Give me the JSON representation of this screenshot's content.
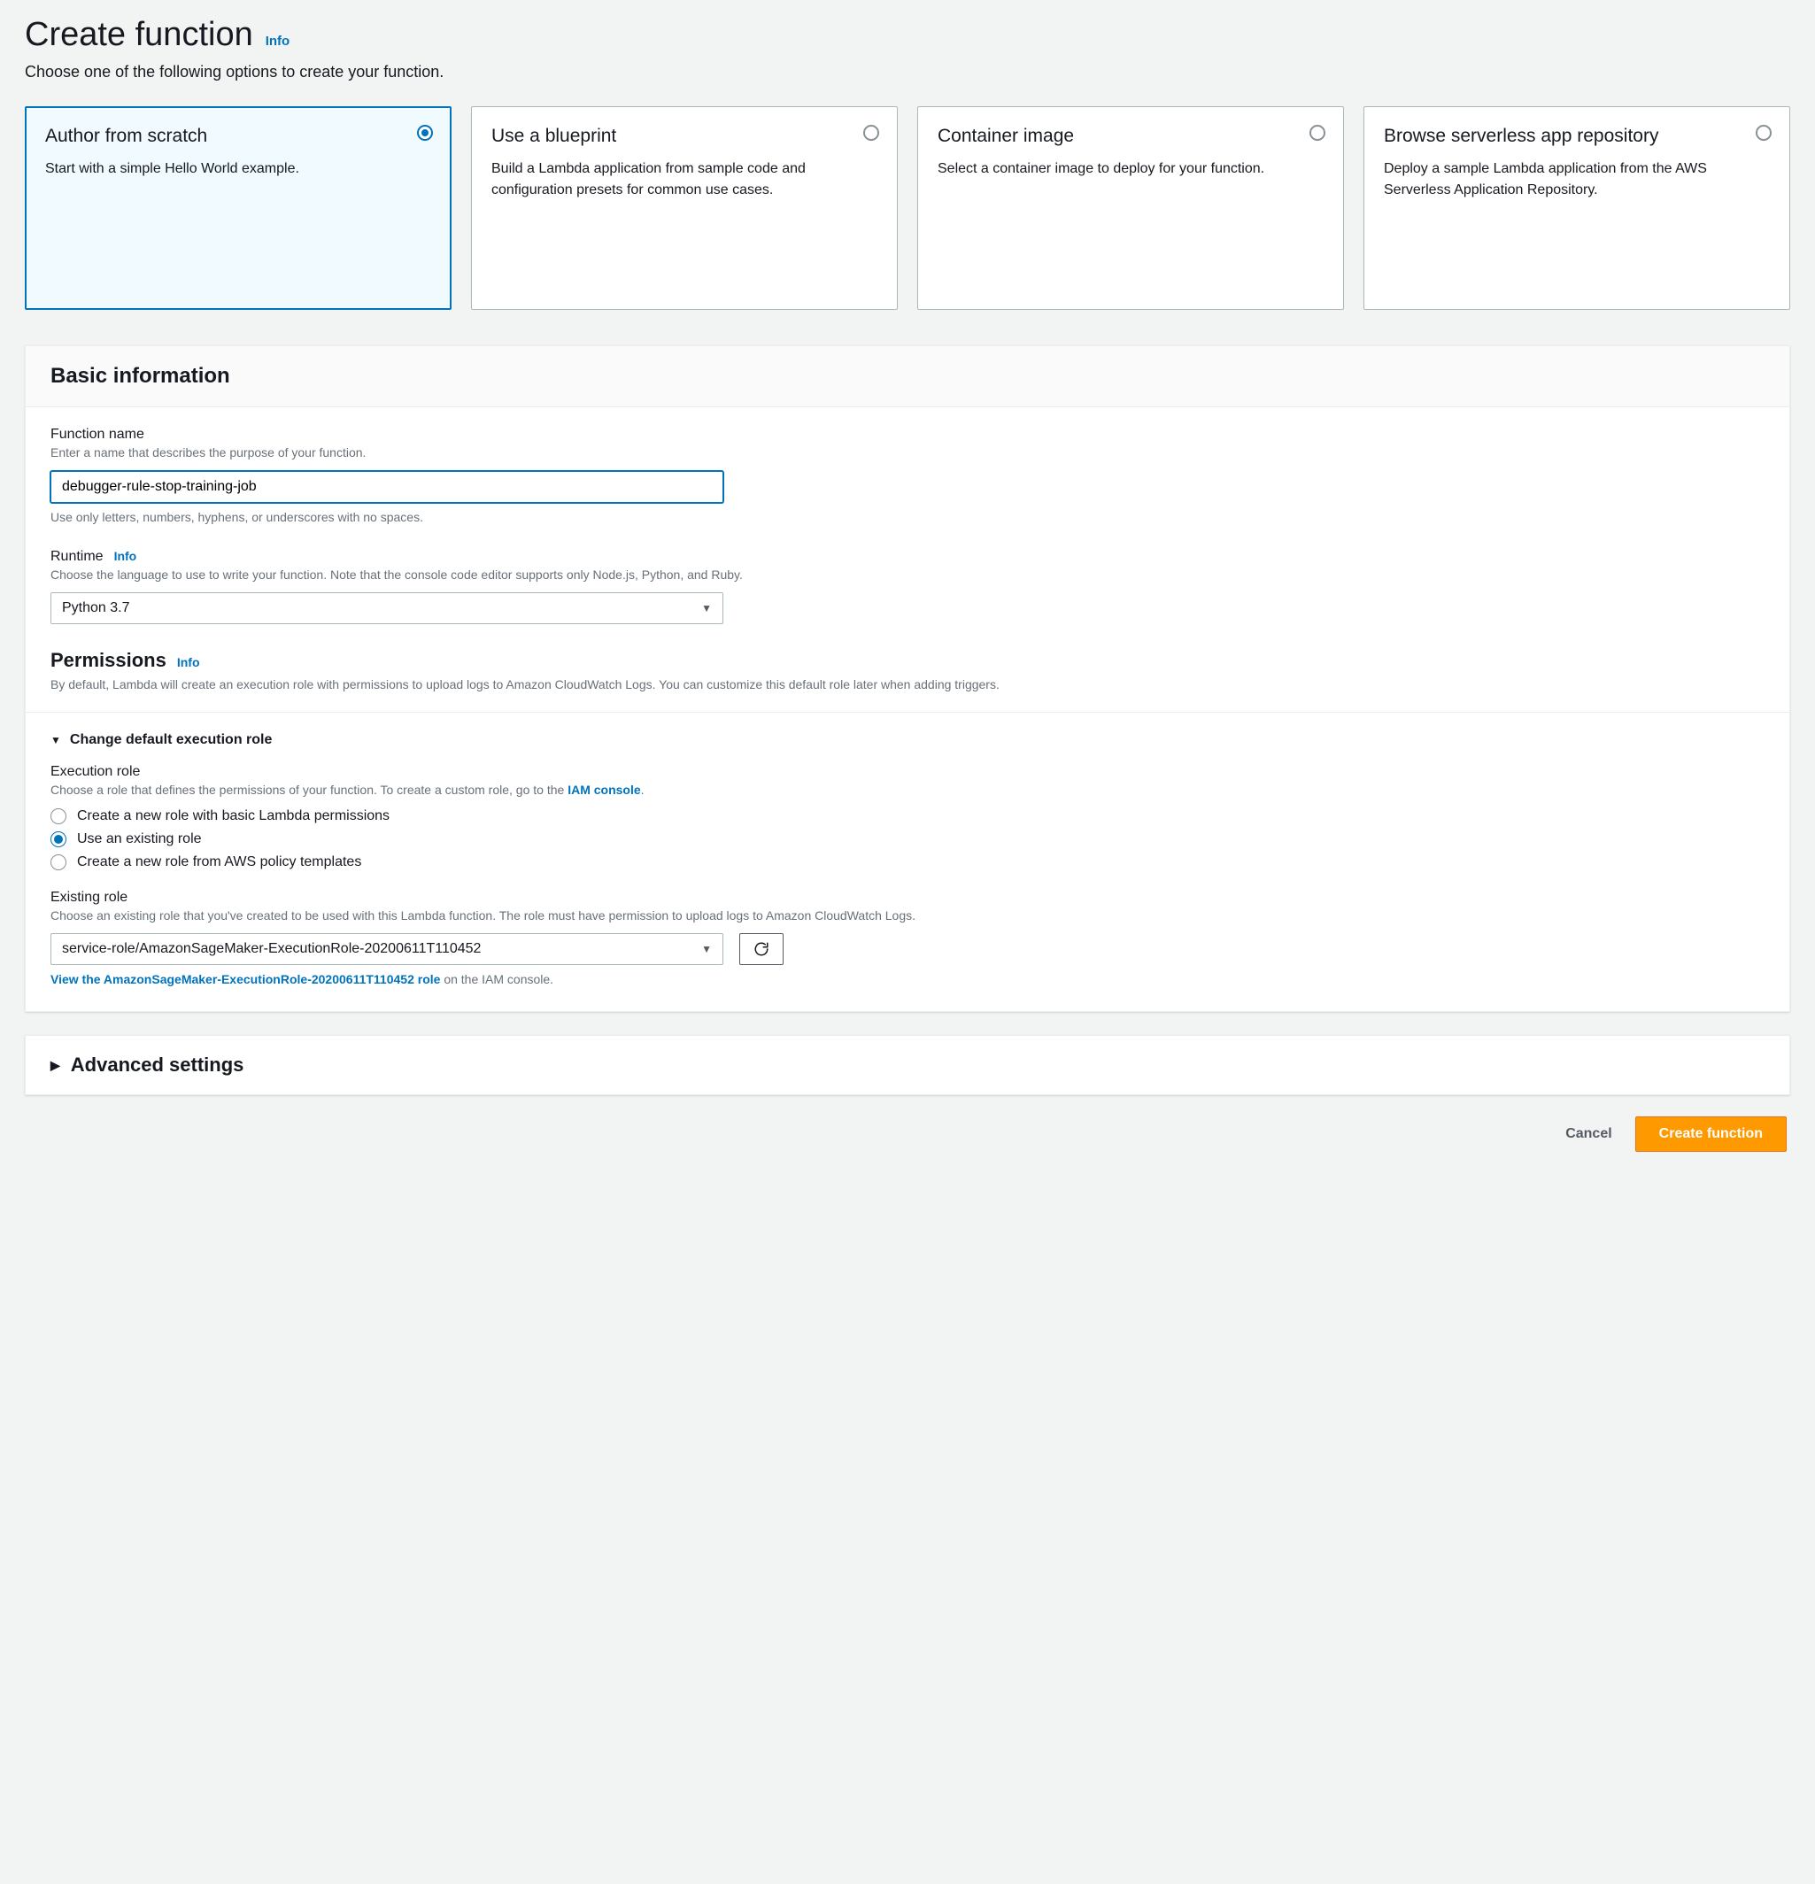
{
  "header": {
    "title": "Create function",
    "info": "Info",
    "subtitle": "Choose one of the following options to create your function."
  },
  "options": [
    {
      "title": "Author from scratch",
      "desc": "Start with a simple Hello World example.",
      "selected": true
    },
    {
      "title": "Use a blueprint",
      "desc": "Build a Lambda application from sample code and configuration presets for common use cases.",
      "selected": false
    },
    {
      "title": "Container image",
      "desc": "Select a container image to deploy for your function.",
      "selected": false
    },
    {
      "title": "Browse serverless app repository",
      "desc": "Deploy a sample Lambda application from the AWS Serverless Application Repository.",
      "selected": false
    }
  ],
  "basic": {
    "panel_title": "Basic information",
    "function_name": {
      "label": "Function name",
      "hint": "Enter a name that describes the purpose of your function.",
      "value": "debugger-rule-stop-training-job",
      "footnote": "Use only letters, numbers, hyphens, or underscores with no spaces."
    },
    "runtime": {
      "label": "Runtime",
      "info": "Info",
      "hint": "Choose the language to use to write your function. Note that the console code editor supports only Node.js, Python, and Ruby.",
      "value": "Python 3.7"
    },
    "permissions": {
      "label": "Permissions",
      "info": "Info",
      "hint": "By default, Lambda will create an execution role with permissions to upload logs to Amazon CloudWatch Logs. You can customize this default role later when adding triggers."
    },
    "change_role": {
      "toggle_label": "Change default execution role",
      "exec_label": "Execution role",
      "exec_hint_prefix": "Choose a role that defines the permissions of your function. To create a custom role, go to the ",
      "exec_hint_link": "IAM console",
      "exec_hint_suffix": ".",
      "radios": [
        {
          "label": "Create a new role with basic Lambda permissions",
          "selected": false
        },
        {
          "label": "Use an existing role",
          "selected": true
        },
        {
          "label": "Create a new role from AWS policy templates",
          "selected": false
        }
      ],
      "existing_role": {
        "label": "Existing role",
        "hint": "Choose an existing role that you've created to be used with this Lambda function. The role must have permission to upload logs to Amazon CloudWatch Logs.",
        "value": "service-role/AmazonSageMaker-ExecutionRole-20200611T110452",
        "view_link": "View the AmazonSageMaker-ExecutionRole-20200611T110452 role",
        "view_link_suffix": " on the IAM console."
      }
    }
  },
  "advanced": {
    "label": "Advanced settings"
  },
  "actions": {
    "cancel": "Cancel",
    "create": "Create function"
  }
}
